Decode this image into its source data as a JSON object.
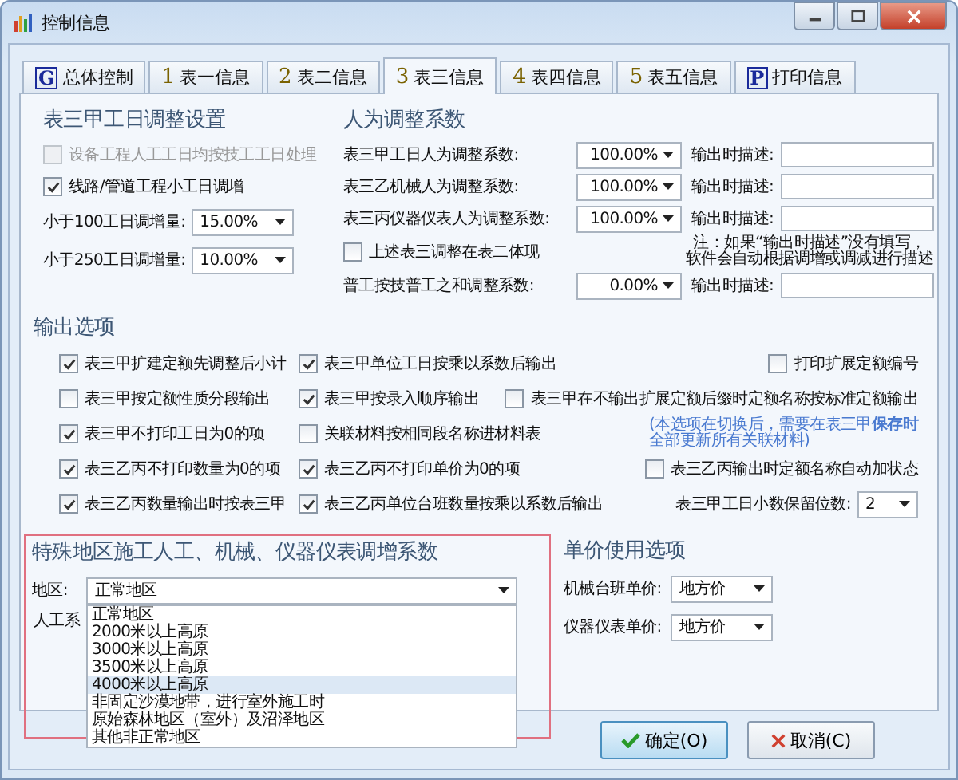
{
  "window": {
    "title": "控制信息"
  },
  "tabs": [
    {
      "kind": "boxed",
      "mark": "G",
      "label": "总体控制",
      "selected": false
    },
    {
      "kind": "number",
      "mark": "1",
      "label": "表一信息",
      "selected": false
    },
    {
      "kind": "number",
      "mark": "2",
      "label": "表二信息",
      "selected": false
    },
    {
      "kind": "number",
      "mark": "3",
      "label": "表三信息",
      "selected": true
    },
    {
      "kind": "number",
      "mark": "4",
      "label": "表四信息",
      "selected": false
    },
    {
      "kind": "number",
      "mark": "5",
      "label": "表五信息",
      "selected": false
    },
    {
      "kind": "boxed",
      "mark": "P",
      "label": "打印信息",
      "selected": false
    }
  ],
  "workday": {
    "title": "表三甲工日调整设置",
    "options": [
      {
        "label": "设备工程人工工日均按技工工日处理",
        "checked": false,
        "disabled": true
      },
      {
        "label": "线路/管道工程小工日调增",
        "checked": true,
        "disabled": false
      }
    ],
    "fields": [
      {
        "label": "小于100工日调增量:",
        "value": "15.00%"
      },
      {
        "label": "小于250工日调增量:",
        "value": "10.00%"
      }
    ]
  },
  "manual": {
    "title": "人为调整系数",
    "rows": [
      {
        "kind": "factor",
        "label": "表三甲工日人为调整系数:",
        "value": "100.00%",
        "desc_label": "输出时描述:"
      },
      {
        "kind": "factor",
        "label": "表三乙机械人为调整系数:",
        "value": "100.00%",
        "desc_label": "输出时描述:"
      },
      {
        "kind": "factor",
        "label": "表三丙仪器仪表人为调整系数:",
        "value": "100.00%",
        "desc_label": "输出时描述:"
      },
      {
        "kind": "checkbox",
        "label": "上述表三调整在表二体现",
        "checked": false,
        "note": [
          "注：如果“输出时描述”没有填写，",
          "软件会自动根据调增或调减进行描述"
        ]
      },
      {
        "kind": "factor",
        "label": "普工按技普工之和调整系数:",
        "value": "0.00%",
        "desc_label": "输出时描述:"
      }
    ]
  },
  "output": {
    "title": "输出选项",
    "rows": [
      [
        {
          "kind": "checkbox",
          "label": "表三甲扩建定额先调整后小计",
          "checked": true
        },
        {
          "kind": "checkbox",
          "label": "表三甲单位工日按乘以系数后输出",
          "checked": true
        },
        {
          "kind": "checkbox",
          "label": "打印扩展定额编号",
          "checked": false
        }
      ],
      [
        {
          "kind": "checkbox",
          "label": "表三甲按定额性质分段输出",
          "checked": false
        },
        {
          "kind": "checkbox",
          "label": "表三甲按录入顺序输出",
          "checked": true
        },
        {
          "kind": "checkbox",
          "label": "表三甲在不输出扩展定额后缀时定额名称按标准定额输出",
          "checked": false
        }
      ],
      [
        {
          "kind": "checkbox",
          "label": "表三甲不打印工日为0的项",
          "checked": true
        },
        {
          "kind": "checkbox",
          "label": "关联材料按相同段名称进材料表",
          "checked": false
        },
        {
          "kind": "note",
          "lines": [
            "(本选项在切换后，需要在表三甲**保存时**",
            "全部更新所有关联材料)"
          ]
        }
      ],
      [
        {
          "kind": "checkbox",
          "label": "表三乙丙不打印数量为0的项",
          "checked": true
        },
        {
          "kind": "checkbox",
          "label": "表三乙丙不打印单价为0的项",
          "checked": true
        },
        {
          "kind": "checkbox",
          "label": "表三乙丙输出时定额名称自动加状态",
          "checked": false
        }
      ],
      [
        {
          "kind": "checkbox",
          "label": "表三乙丙数量输出时按表三甲",
          "checked": true
        },
        {
          "kind": "checkbox",
          "label": "表三乙丙单位台班数量按乘以系数后输出",
          "checked": true
        },
        {
          "kind": "select",
          "label": "表三甲工日小数保留位数:",
          "value": "2"
        }
      ]
    ]
  },
  "special": {
    "title": "特殊地区施工人工、机械、仪器仪表调增系数",
    "region_label": "地区:",
    "region_value": "正常地区",
    "hidden_label": "人工系",
    "options": [
      {
        "label": "正常地区",
        "selected": false
      },
      {
        "label": "2000米以上高原",
        "selected": false
      },
      {
        "label": "3000米以上高原",
        "selected": false
      },
      {
        "label": "3500米以上高原",
        "selected": false
      },
      {
        "label": "4000米以上高原",
        "selected": true
      },
      {
        "label": "非固定沙漠地带，进行室外施工时",
        "selected": false
      },
      {
        "label": "原始森林地区（室外）及沼泽地区",
        "selected": false
      },
      {
        "label": "其他非正常地区",
        "selected": false
      }
    ]
  },
  "price": {
    "title": "单价使用选项",
    "fields": [
      {
        "label": "机械台班单价:",
        "value": "地方价"
      },
      {
        "label": "仪器仪表单价:",
        "value": "地方价"
      }
    ]
  },
  "buttons": [
    {
      "kind": "ok",
      "label": "确定(O)"
    },
    {
      "kind": "cancel",
      "label": "取消(C)"
    }
  ]
}
